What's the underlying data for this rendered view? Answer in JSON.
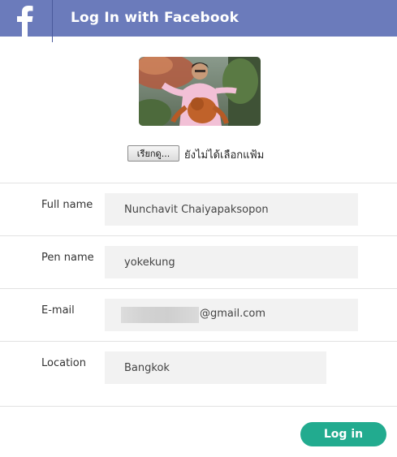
{
  "header": {
    "logo_letter": "f",
    "title": "Log In with Facebook",
    "background_color": "#6b7bbb"
  },
  "profile": {
    "photo_icon": "profile-photo"
  },
  "file_upload": {
    "button_label": "เรียกดู...",
    "status_text": "ยังไม่ได้เลือกแฟ้ม"
  },
  "form": {
    "full_name": {
      "label": "Full name",
      "value": "Nunchavit Chaiyapaksopon"
    },
    "pen_name": {
      "label": "Pen name",
      "value": "yokekung"
    },
    "email": {
      "label": "E-mail",
      "visible_value": "@gmail.com"
    },
    "location": {
      "label": "Location",
      "value": "Bangkok"
    }
  },
  "login_button": {
    "label": "Log in",
    "color": "#22ab8f"
  }
}
